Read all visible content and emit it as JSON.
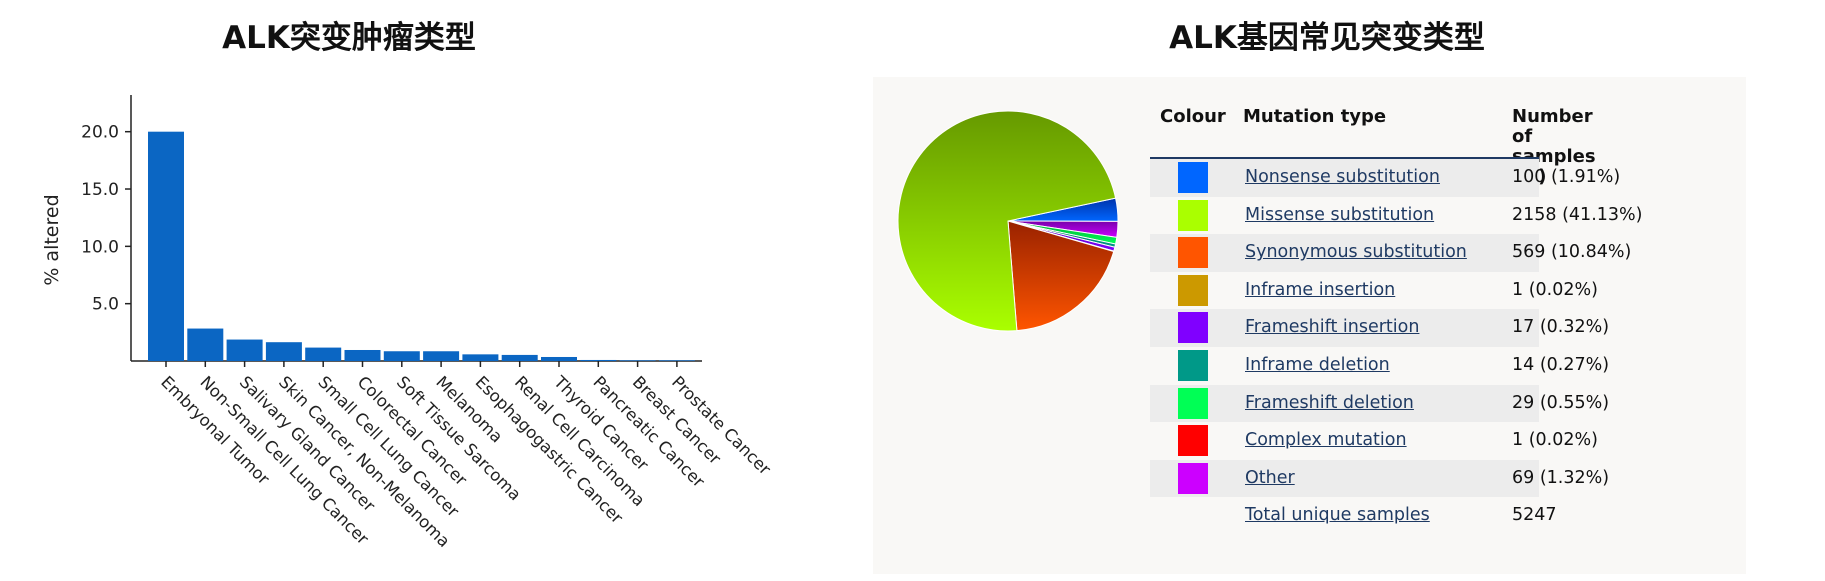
{
  "left_title": "ALK突变肿瘤类型",
  "right_title": "ALK基因常见突变类型",
  "chart_data": [
    {
      "type": "bar",
      "title": "ALK突变肿瘤类型",
      "ylabel": "% altered",
      "xlabel": "",
      "ylim": [
        0,
        23.2
      ],
      "yticks": [
        "5.0",
        "10.0",
        "15.0",
        "20.0"
      ],
      "grid": false,
      "color": "#0b66c3",
      "categories": [
        "Embryonal Tumor",
        "Non-Small Cell Lung Cancer",
        "Salivary Gland Cancer",
        "Skin Cancer, Non-Melanoma",
        "Small Cell Lung Cancer",
        "Colorectal Cancer",
        "Soft Tissue Sarcoma",
        "Melanoma",
        "Esophagogastric Cancer",
        "Renal Cell Carcinoma",
        "Thyroid Cancer",
        "Pancreatic Cancer",
        "Breast Cancer",
        "Prostate Cancer"
      ],
      "values": [
        20.0,
        2.83,
        1.87,
        1.64,
        1.17,
        0.96,
        0.85,
        0.85,
        0.58,
        0.53,
        0.35,
        0.09,
        0.06,
        0.06
      ]
    },
    {
      "type": "pie",
      "title": "ALK基因常见突变类型",
      "legend_placement": "right",
      "headers": {
        "colour": "Colour",
        "type": "Mutation type",
        "count_line1": "Number of",
        "count_line2": "samples (%)"
      },
      "slices": [
        {
          "label": "Nonsense substitution",
          "count": 100,
          "text": "100 (1.91%)",
          "color": "#0066ff",
          "dark": "#0033aa"
        },
        {
          "label": "Missense substitution",
          "count": 2158,
          "text": "2158 (41.13%)",
          "color": "#aaff00",
          "dark": "#669900"
        },
        {
          "label": "Synonymous substitution",
          "count": 569,
          "text": "569 (10.84%)",
          "color": "#ff5500",
          "dark": "#992200"
        },
        {
          "label": "Inframe insertion",
          "count": 1,
          "text": "1 (0.02%)",
          "color": "#cc9900",
          "dark": "#886600"
        },
        {
          "label": "Frameshift insertion",
          "count": 17,
          "text": "17 (0.32%)",
          "color": "#8000ff",
          "dark": "#5000aa"
        },
        {
          "label": "Inframe deletion",
          "count": 14,
          "text": "14 (0.27%)",
          "color": "#009988",
          "dark": "#006655"
        },
        {
          "label": "Frameshift deletion",
          "count": 29,
          "text": "29 (0.55%)",
          "color": "#00ff55",
          "dark": "#00aa33"
        },
        {
          "label": "Complex mutation",
          "count": 1,
          "text": "1 (0.02%)",
          "color": "#ff0000",
          "dark": "#aa0000"
        },
        {
          "label": "Other",
          "count": 69,
          "text": "69 (1.32%)",
          "color": "#cc00ff",
          "dark": "#7700aa"
        }
      ],
      "total_label": "Total unique samples",
      "total_value": "5247"
    }
  ]
}
